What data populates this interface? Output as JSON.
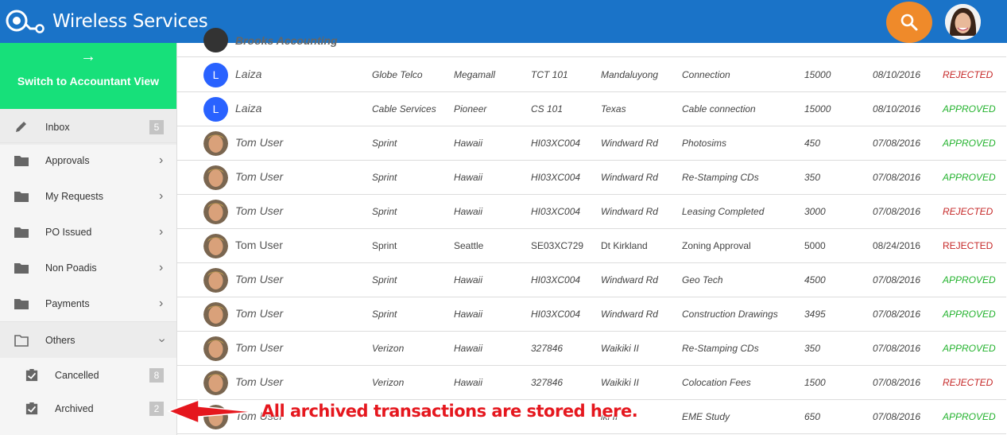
{
  "header": {
    "title": "Wireless Services",
    "icons": {
      "logo": "app-logo-icon",
      "search": "search-icon",
      "avatar": "user-avatar"
    },
    "colors": {
      "bar": "#1a73c8",
      "search": "#ef8a2a"
    }
  },
  "sidebar": {
    "switch_arrow": "→",
    "switch_label": "Switch to Accountant View",
    "items": [
      {
        "label": "Inbox",
        "icon": "pencil-icon",
        "badge": "5"
      },
      {
        "label": "Approvals",
        "icon": "folder-icon"
      },
      {
        "label": "My Requests",
        "icon": "folder-icon"
      },
      {
        "label": "PO Issued",
        "icon": "folder-icon"
      },
      {
        "label": "Non Poadis",
        "icon": "folder-icon"
      },
      {
        "label": "Payments",
        "icon": "folder-icon"
      },
      {
        "label": "Others",
        "icon": "folder-open-icon"
      }
    ],
    "sub_items": [
      {
        "label": "Cancelled",
        "icon": "checklist-icon",
        "badge": "8"
      },
      {
        "label": "Archived",
        "icon": "checklist-icon",
        "badge": "2"
      }
    ]
  },
  "table": {
    "top_partial_row": {
      "name": "Brooks Accounting"
    },
    "rows": [
      {
        "initial": "L",
        "name": "Laiza",
        "vendor": "Globe Telco",
        "location": "Megamall",
        "code": "TCT 101",
        "address": "Mandaluyong",
        "description": "Connection",
        "amount": "15000",
        "date": "08/10/2016",
        "status": "REJECTED"
      },
      {
        "initial": "L",
        "name": "Laiza",
        "vendor": "Cable Services",
        "location": "Pioneer",
        "code": "CS 101",
        "address": "Texas",
        "description": "Cable connection",
        "amount": "15000",
        "date": "08/10/2016",
        "status": "APPROVED"
      },
      {
        "initial": "",
        "name": "Tom User",
        "vendor": "Sprint",
        "location": "Hawaii",
        "code": "HI03XC004",
        "address": "Windward Rd",
        "description": "Photosims",
        "amount": "450",
        "date": "07/08/2016",
        "status": "APPROVED"
      },
      {
        "initial": "",
        "name": "Tom User",
        "vendor": "Sprint",
        "location": "Hawaii",
        "code": "HI03XC004",
        "address": "Windward Rd",
        "description": "Re-Stamping CDs",
        "amount": "350",
        "date": "07/08/2016",
        "status": "APPROVED"
      },
      {
        "initial": "",
        "name": "Tom User",
        "vendor": "Sprint",
        "location": "Hawaii",
        "code": "HI03XC004",
        "address": "Windward Rd",
        "description": "Leasing Completed",
        "amount": "3000",
        "date": "07/08/2016",
        "status": "REJECTED"
      },
      {
        "initial": "",
        "name": "Tom User",
        "vendor": "Sprint",
        "location": "Seattle",
        "code": "SE03XC729",
        "address": "Dt Kirkland",
        "description": "Zoning Approval",
        "amount": "5000",
        "date": "08/24/2016",
        "status": "REJECTED"
      },
      {
        "initial": "",
        "name": "Tom User",
        "vendor": "Sprint",
        "location": "Hawaii",
        "code": "HI03XC004",
        "address": "Windward Rd",
        "description": "Geo Tech",
        "amount": "4500",
        "date": "07/08/2016",
        "status": "APPROVED"
      },
      {
        "initial": "",
        "name": "Tom User",
        "vendor": "Sprint",
        "location": "Hawaii",
        "code": "HI03XC004",
        "address": "Windward Rd",
        "description": "Construction Drawings",
        "amount": "3495",
        "date": "07/08/2016",
        "status": "APPROVED"
      },
      {
        "initial": "",
        "name": "Tom User",
        "vendor": "Verizon",
        "location": "Hawaii",
        "code": "327846",
        "address": "Waikiki II",
        "description": "Re-Stamping CDs",
        "amount": "350",
        "date": "07/08/2016",
        "status": "APPROVED"
      },
      {
        "initial": "",
        "name": "Tom User",
        "vendor": "Verizon",
        "location": "Hawaii",
        "code": "327846",
        "address": "Waikiki II",
        "description": "Colocation Fees",
        "amount": "1500",
        "date": "07/08/2016",
        "status": "REJECTED"
      },
      {
        "initial": "",
        "name": "Tom User",
        "vendor": "",
        "location": "",
        "code": "",
        "address": "iki II",
        "description": "EME Study",
        "amount": "650",
        "date": "07/08/2016",
        "status": "APPROVED"
      }
    ]
  },
  "callout": {
    "text": "All archived transactions are stored here.",
    "color": "#e5171e"
  }
}
